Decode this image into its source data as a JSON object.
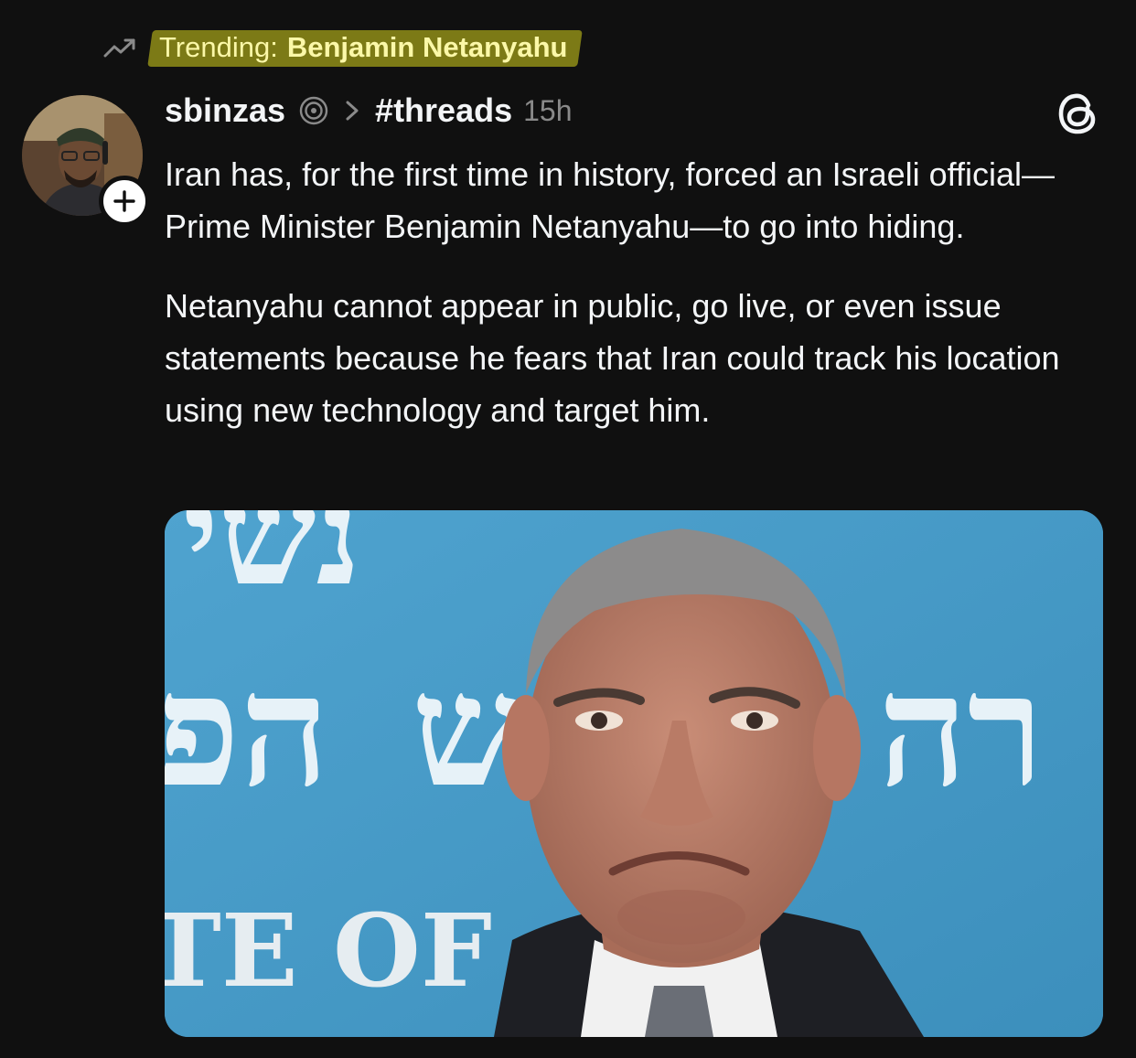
{
  "trending": {
    "label": "Trending:",
    "topic": "Benjamin Netanyahu"
  },
  "post": {
    "username": "sbinzas",
    "topic": "#threads",
    "time": "15h",
    "paragraphs": [
      "Iran has, for the first time in history, forced an Israeli official—Prime Minister Benjamin Netanyahu—to go into hiding.",
      "Netanyahu cannot appear in public, go live, or even issue statements because he fears that Iran could track his location using new technology and target him."
    ],
    "image": {
      "backdrop_letters_top": "נשי",
      "backdrop_letters_mid_left": "הפ",
      "backdrop_letters_mid_center": "ש",
      "backdrop_letters_right": "רה",
      "backdrop_text_bottom": "TE OF"
    }
  },
  "icons": {
    "trending": "trending-up-icon",
    "verified": "verified-icon",
    "chevron": "chevron-right-icon",
    "follow": "plus-icon",
    "app": "threads-logo-icon"
  },
  "colors": {
    "background": "#101010",
    "text": "#f3f5f7",
    "muted": "#8a8a8a",
    "trending_highlight": "#d6d21c",
    "trending_text": "#fbf8a8"
  }
}
